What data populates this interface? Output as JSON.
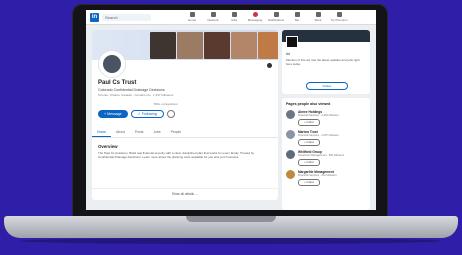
{
  "topbar": {
    "logo": "in",
    "search_placeholder": "Search",
    "nav": [
      "Home",
      "Network",
      "Jobs",
      "Messaging",
      "Notifications",
      "Me",
      "Work",
      "Try Premium"
    ]
  },
  "profile": {
    "name": "Paul Cs Trust",
    "headline": "Colorado Confidential Drainage Decisions",
    "location": "Toronto, Ontario, Canada · Contact info · 1,437 followers",
    "connections": "500+ connections",
    "buttons": {
      "primary": "+ Message",
      "secondary": "✓ Following"
    },
    "tabs": [
      "Home",
      "About",
      "Posts",
      "Jobs",
      "People"
    ],
    "overview_title": "Overview",
    "overview_text": "The Paul Cs Academy: Build real financial security with a clear, disciplined plan that works for every family. Trusted by Confidential Drainage Decisions. Learn more about the planning tools available for you and your business.",
    "show_all": "Show all details →"
  },
  "ad": {
    "label": "Ad",
    "text": "Mention of this ad. Get the latest updates and jobs right here today.",
    "button": "Follow"
  },
  "people": {
    "title": "Pages people also viewed",
    "items": [
      {
        "name": "Aimee Holdings",
        "sub": "Financial Services · 2,318 followers",
        "button": "+ Follow"
      },
      {
        "name": "Marlow Trust",
        "sub": "Financial Services · 1,007 followers",
        "button": "+ Follow"
      },
      {
        "name": "Whitfield Group",
        "sub": "Investment Management · 894 followers",
        "button": "+ Follow"
      },
      {
        "name": "Margaritte Management",
        "sub": "Financial Services · 612 followers",
        "button": "+ Follow"
      }
    ]
  },
  "colors": {
    "accent": "#0a66c2",
    "background": "#2f1fa8"
  }
}
